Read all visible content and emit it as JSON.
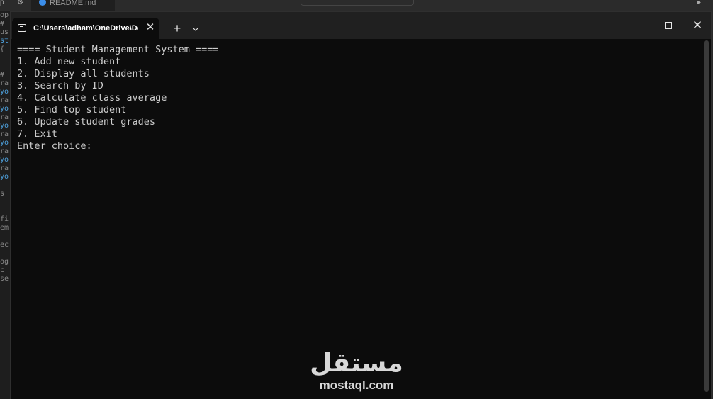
{
  "background_app": {
    "tab_label": "README.md",
    "left_gutter_text": [
      "op",
      "#",
      "us",
      "st",
      "{",
      "",
      "",
      "#",
      "ra",
      "yo",
      "ra",
      "yo",
      "ra",
      "yo",
      "ra",
      "yo",
      "ra",
      "yo",
      "ra",
      "yo",
      "",
      "s",
      "",
      "",
      "fi",
      "em",
      "",
      "ec",
      "",
      "og",
      "c",
      "se"
    ]
  },
  "terminal": {
    "tab_title": "C:\\Users\\adham\\OneDrive\\De",
    "tab_icon": "terminal-icon",
    "new_tab_symbol": "+",
    "dropdown_symbol": "⌄",
    "close_symbol": "✕",
    "lines": [
      "==== Student Management System ====",
      "1. Add new student",
      "2. Display all students",
      "3. Search by ID",
      "4. Calculate class average",
      "5. Find top student",
      "6. Update student grades",
      "7. Exit",
      "Enter choice:"
    ]
  },
  "watermark": {
    "arabic": "مستقل",
    "latin": "mostaql.com"
  },
  "colors": {
    "console_bg": "#0c0c0c",
    "titlebar_bg": "#202020",
    "text": "#cccccc"
  }
}
